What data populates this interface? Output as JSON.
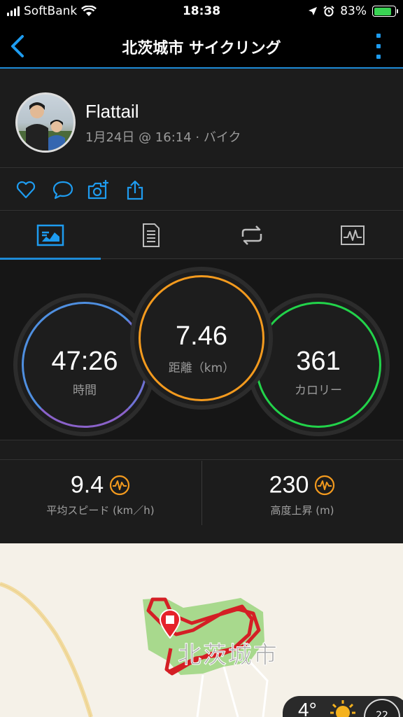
{
  "status_bar": {
    "carrier": "SoftBank",
    "time": "18:38",
    "battery": "83%"
  },
  "nav": {
    "title": "北茨城市 サイクリング"
  },
  "profile": {
    "name": "Flattail",
    "meta": "1月24日 @ 16:14 · バイク"
  },
  "actions": [
    "heart-icon",
    "comment-icon",
    "camera-add-icon",
    "share-icon"
  ],
  "tabs": [
    "overview-tab",
    "details-tab",
    "laps-tab",
    "charts-tab"
  ],
  "circles": {
    "time": {
      "value": "47:26",
      "label": "時間"
    },
    "distance": {
      "value": "7.46",
      "label": "距離（km）"
    },
    "calories": {
      "value": "361",
      "label": "カロリー"
    }
  },
  "stats": {
    "avg_speed": {
      "value": "9.4",
      "label": "平均スピード (km／h)"
    },
    "elevation": {
      "value": "230",
      "label": "高度上昇 (m)"
    }
  },
  "map": {
    "place_label": "北茨城市"
  },
  "weather": {
    "temp": "4°",
    "index": "22"
  },
  "colors": {
    "accent": "#1e8ad6",
    "time_ring": "#4f8fe0",
    "distance_ring": "#f39a1e",
    "calories_ring": "#22d34a",
    "route": "#d41f25"
  }
}
